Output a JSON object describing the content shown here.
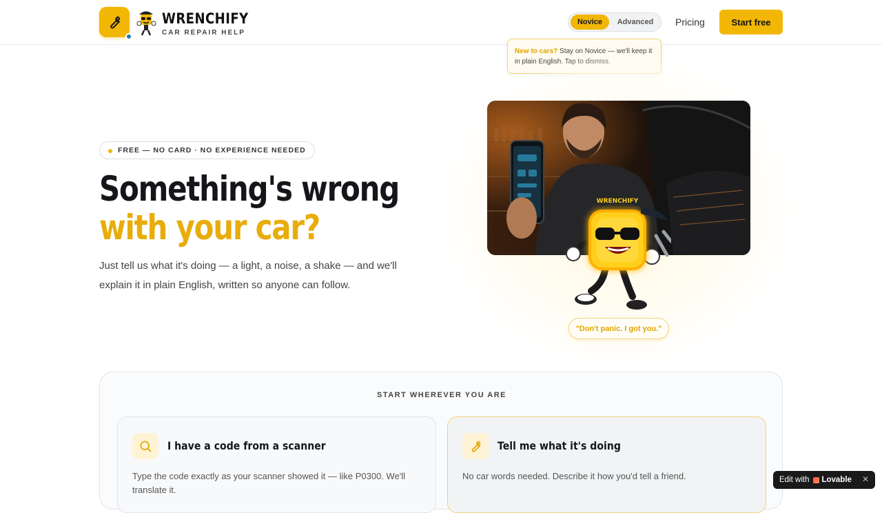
{
  "header": {
    "brand_name": "WRENCHIFY",
    "brand_tagline": "CAR REPAIR HELP",
    "logo_icon": "wrench-icon",
    "mode_novice": "Novice",
    "mode_advanced": "Advanced",
    "nav_pricing": "Pricing",
    "cta": "Start free"
  },
  "tooltip": {
    "lead": "New to cars?",
    "text": " Stay on Novice — we'll keep it in plain English. Tap to dismiss."
  },
  "hero": {
    "badge": "FREE — NO CARD · NO EXPERIENCE NEEDED",
    "title_line1": "Something's wrong",
    "title_line2": "with your car?",
    "lead": "Just tell us what it's doing — a light, a noise, a shake — and we'll explain it in plain English, written so anyone can follow.",
    "mascot_quote": "\"Don't panic. I got you.\"",
    "mascot_cap_text": "WRENCHIFY"
  },
  "start_panel": {
    "title": "START WHEREVER YOU ARE",
    "cards": [
      {
        "icon": "search-icon",
        "title": "I have a code from a scanner",
        "text": "Type the code exactly as your scanner showed it — like P0300. We'll translate it."
      },
      {
        "icon": "wrench-icon",
        "title": "Tell me what it's doing",
        "text": "No car words needed. Describe it how you'd tell a friend."
      }
    ]
  },
  "lovable_badge": {
    "prefix": "Edit with",
    "brand": "Lovable"
  },
  "colors": {
    "accent": "#f2b705",
    "accent_text": "#e8ad0a",
    "dot_blue": "#1f7ab8"
  }
}
